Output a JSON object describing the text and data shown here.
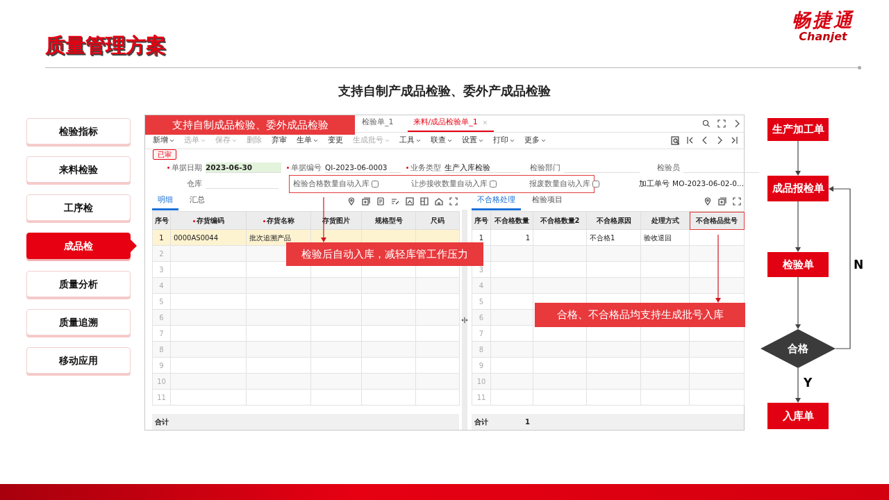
{
  "header": {
    "title": "质量管理方案",
    "logo": "畅捷通",
    "logo_subtext": "Chanjet"
  },
  "heading": "支持自制产成品检验、委外产成品检验",
  "nav": [
    {
      "label": "检验指标",
      "selected": false
    },
    {
      "label": "来料检验",
      "selected": false
    },
    {
      "label": "工序检",
      "selected": false
    },
    {
      "label": "成品检",
      "selected": true
    },
    {
      "label": "质量分析",
      "selected": false
    },
    {
      "label": "质量追溯",
      "selected": false
    },
    {
      "label": "移动应用",
      "selected": false
    }
  ],
  "app": {
    "tabs": [
      {
        "label": "检验单_1",
        "selected": false,
        "closable": false
      },
      {
        "label": "来料/成品检验单_1",
        "selected": true,
        "closable": true
      }
    ],
    "toolbar": [
      {
        "label": "新增",
        "disabled": false,
        "dropdown": true
      },
      {
        "label": "选单",
        "disabled": true,
        "dropdown": true
      },
      {
        "label": "保存",
        "disabled": true,
        "dropdown": true
      },
      {
        "label": "删除",
        "disabled": true,
        "dropdown": false
      },
      {
        "label": "弃审",
        "disabled": false,
        "dropdown": false
      },
      {
        "label": "生单",
        "disabled": false,
        "dropdown": true
      },
      {
        "label": "变更",
        "disabled": false,
        "dropdown": false
      },
      {
        "label": "生成批号",
        "disabled": true,
        "dropdown": true
      },
      {
        "label": "工具",
        "disabled": false,
        "dropdown": true
      },
      {
        "label": "联查",
        "disabled": false,
        "dropdown": true
      },
      {
        "label": "设置",
        "disabled": false,
        "dropdown": true
      },
      {
        "label": "打印",
        "disabled": false,
        "dropdown": true
      },
      {
        "label": "更多",
        "disabled": false,
        "dropdown": true
      }
    ],
    "status_badge": "已审",
    "fields": [
      {
        "label": "单据日期",
        "required": true,
        "value": "2023-06-30",
        "highlighted": true
      },
      {
        "label": "单据编号",
        "required": true,
        "value": "QI-2023-06-0003",
        "highlighted": false
      },
      {
        "label": "业务类型",
        "required": true,
        "value": "生产入库检验",
        "highlighted": false
      },
      {
        "label": "检验部门",
        "required": false,
        "highlighted": false
      },
      {
        "label": "检验员",
        "required": false,
        "highlighted": false
      }
    ],
    "warehouse_label": "仓库",
    "checkbox_group_highlighted": true,
    "checkboxes": [
      {
        "label": "检验合格数量自动入库",
        "checked": false
      },
      {
        "label": "让步接收数量自动入库",
        "checked": false
      },
      {
        "label": "报废数量自动入库",
        "checked": false
      }
    ],
    "job_order": {
      "label": "加工单号",
      "value": "MO-2023-06-02-0..."
    },
    "left": {
      "tabs": [
        {
          "label": "明细",
          "selected": true
        },
        {
          "label": "汇总",
          "selected": false
        }
      ],
      "columns": [
        {
          "label": "序号",
          "required": false,
          "highlighted": false
        },
        {
          "label": "存货编码",
          "required": true,
          "highlighted": false
        },
        {
          "label": "存货名称",
          "required": true,
          "highlighted": false
        },
        {
          "label": "存货图片",
          "required": false,
          "highlighted": false
        },
        {
          "label": "规格型号",
          "required": false,
          "highlighted": false
        },
        {
          "label": "尺码",
          "required": false,
          "highlighted": false
        }
      ],
      "rows": [
        {
          "selected": true,
          "cells": [
            "1",
            "0000AS0044",
            "批次追溯产品"
          ]
        },
        {
          "selected": false,
          "cells": [
            "2"
          ]
        },
        {
          "selected": false,
          "cells": [
            "3"
          ]
        },
        {
          "selected": false,
          "cells": [
            "4"
          ]
        },
        {
          "selected": false,
          "cells": [
            "5"
          ]
        },
        {
          "selected": false,
          "cells": [
            "6"
          ]
        },
        {
          "selected": false,
          "cells": [
            "7"
          ]
        },
        {
          "selected": false,
          "cells": [
            "8"
          ]
        },
        {
          "selected": false,
          "cells": [
            "9"
          ]
        },
        {
          "selected": false,
          "cells": [
            "10"
          ]
        },
        {
          "selected": false,
          "cells": [
            "11"
          ]
        }
      ],
      "footer": [
        "合计"
      ]
    },
    "right": {
      "tabs": [
        {
          "label": "不合格处理",
          "selected": true
        },
        {
          "label": "检验项目",
          "selected": false
        }
      ],
      "columns": [
        {
          "label": "序号",
          "required": false,
          "highlighted": false
        },
        {
          "label": "不合格数量",
          "required": false,
          "highlighted": false
        },
        {
          "label": "不合格数量2",
          "required": false,
          "highlighted": false
        },
        {
          "label": "不合格原因",
          "required": false,
          "highlighted": false
        },
        {
          "label": "处理方式",
          "required": false,
          "highlighted": false
        },
        {
          "label": "不合格品批号",
          "required": false,
          "highlighted": true
        }
      ],
      "rows": [
        {
          "selected": false,
          "cells": [
            "1",
            "1",
            null,
            "不合格1",
            "验收退回"
          ]
        },
        {
          "selected": false
        },
        {
          "selected": false,
          "cells": [
            "3"
          ]
        },
        {
          "selected": false,
          "cells": [
            "4"
          ]
        },
        {
          "selected": false,
          "cells": [
            "5"
          ]
        },
        {
          "selected": false,
          "cells": [
            "6"
          ]
        },
        {
          "selected": false,
          "cells": [
            "7"
          ]
        },
        {
          "selected": false,
          "cells": [
            "8"
          ]
        },
        {
          "selected": false,
          "cells": [
            "9"
          ]
        },
        {
          "selected": false,
          "cells": [
            "10"
          ]
        },
        {
          "selected": false,
          "cells": [
            "11"
          ]
        }
      ],
      "footer": [
        "合计",
        "1"
      ]
    },
    "annotations": [
      "支持自制成品检验、委外成品检验",
      "检验后自动入库，减轻库管工作压力",
      "合格、不合格品均支持生成批号入库"
    ]
  },
  "flow": {
    "nodes": [
      {
        "label": "生产加工单",
        "kind": "process"
      },
      {
        "label": "成品报检单",
        "kind": "process"
      },
      {
        "label": "检验单",
        "kind": "process"
      },
      {
        "label": "合格",
        "kind": "decision"
      },
      {
        "label": "入库单",
        "kind": "process"
      }
    ],
    "branch_labels": [
      "N",
      "Y"
    ]
  }
}
